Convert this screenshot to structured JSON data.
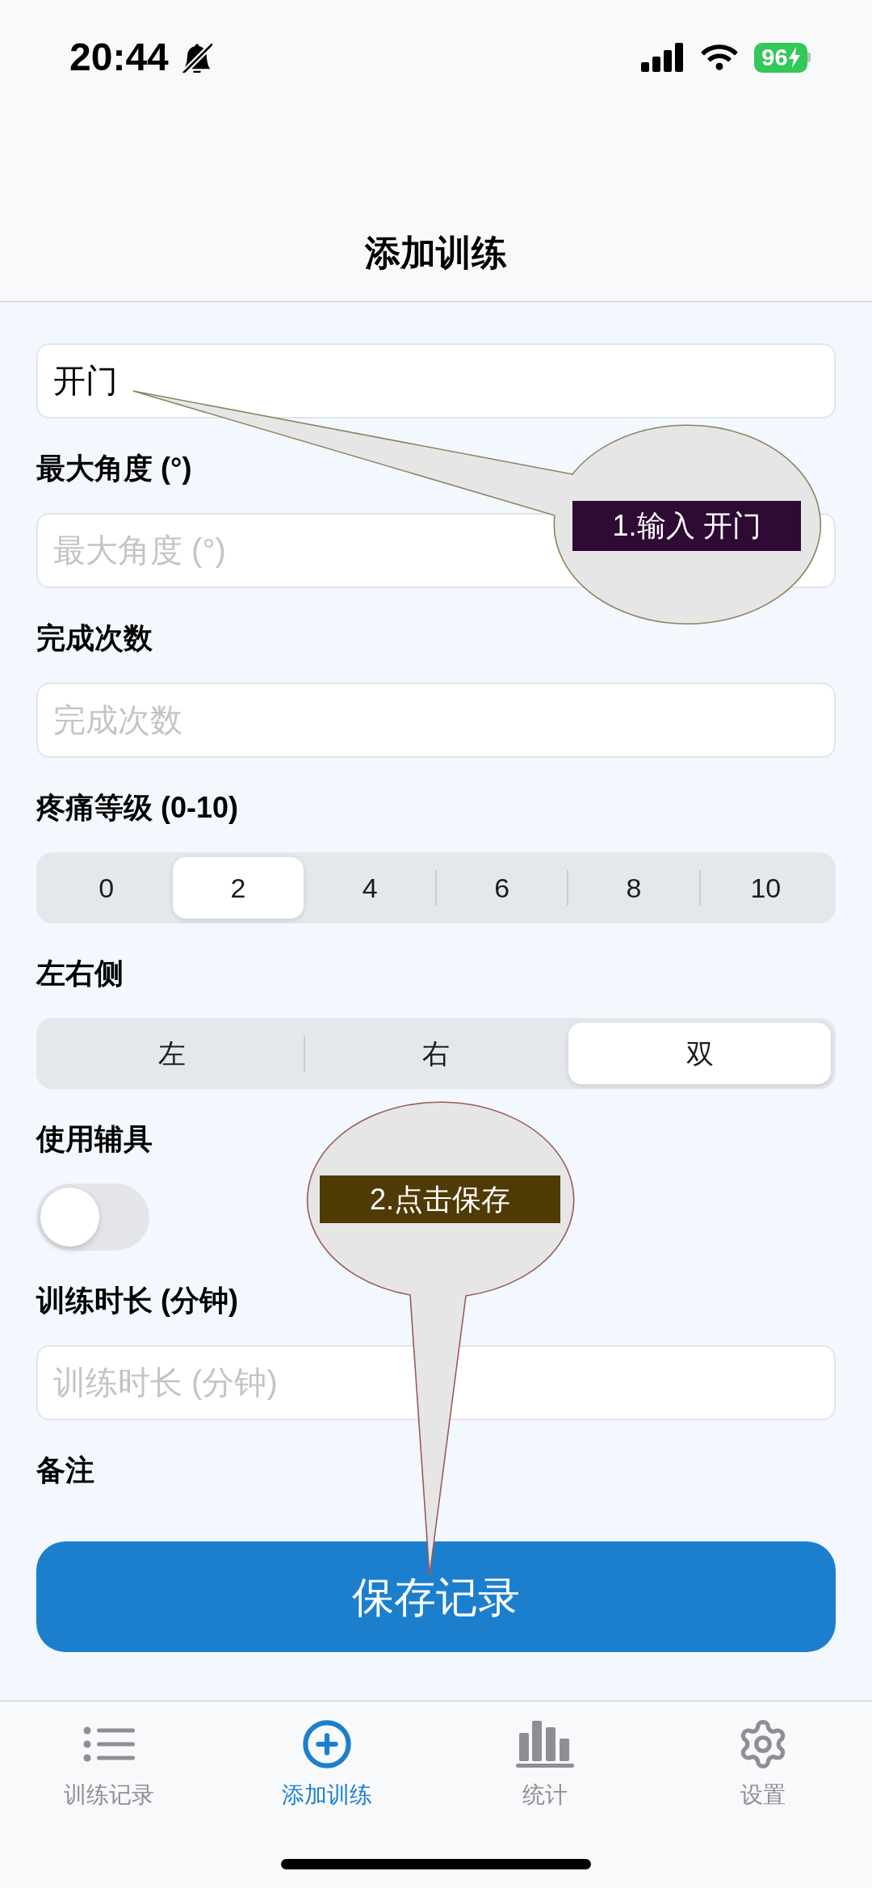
{
  "status_bar": {
    "time": "20:44",
    "battery": "96"
  },
  "nav_bar": {
    "title": "添加训练"
  },
  "form": {
    "fields": [
      {
        "kind": "input",
        "value": "开门"
      },
      {
        "kind": "input",
        "label": "最大角度 (°)",
        "placeholder": "最大角度 (°)"
      },
      {
        "kind": "input",
        "label": "完成次数",
        "placeholder": "完成次数"
      },
      {
        "kind": "segmented",
        "label": "疼痛等级 (0-10)",
        "options": [
          {
            "label": "0",
            "selected": false
          },
          {
            "label": "2",
            "selected": true
          },
          {
            "label": "4",
            "selected": false
          },
          {
            "label": "6",
            "selected": false
          },
          {
            "label": "8",
            "selected": false
          },
          {
            "label": "10",
            "selected": false
          }
        ]
      },
      {
        "kind": "segmented",
        "label": "左右侧",
        "options": [
          {
            "label": "左",
            "selected": false
          },
          {
            "label": "右",
            "selected": false
          },
          {
            "label": "双",
            "selected": true
          }
        ]
      },
      {
        "kind": "toggle",
        "label": "使用辅具",
        "on": false
      },
      {
        "kind": "input",
        "label": "训练时长 (分钟)",
        "placeholder": "训练时长 (分钟)"
      },
      {
        "kind": "heading",
        "label": "备注"
      }
    ],
    "save_button": "保存记录"
  },
  "annotations": [
    {
      "text": "1.输入 开门",
      "color": "#2e0a35"
    },
    {
      "text": "2.点击保存",
      "color": "#503a05"
    }
  ],
  "tab_bar": [
    {
      "label": "训练记录",
      "selected": false
    },
    {
      "label": "添加训练",
      "selected": true
    },
    {
      "label": "统计",
      "selected": false
    },
    {
      "label": "设置",
      "selected": false
    }
  ]
}
